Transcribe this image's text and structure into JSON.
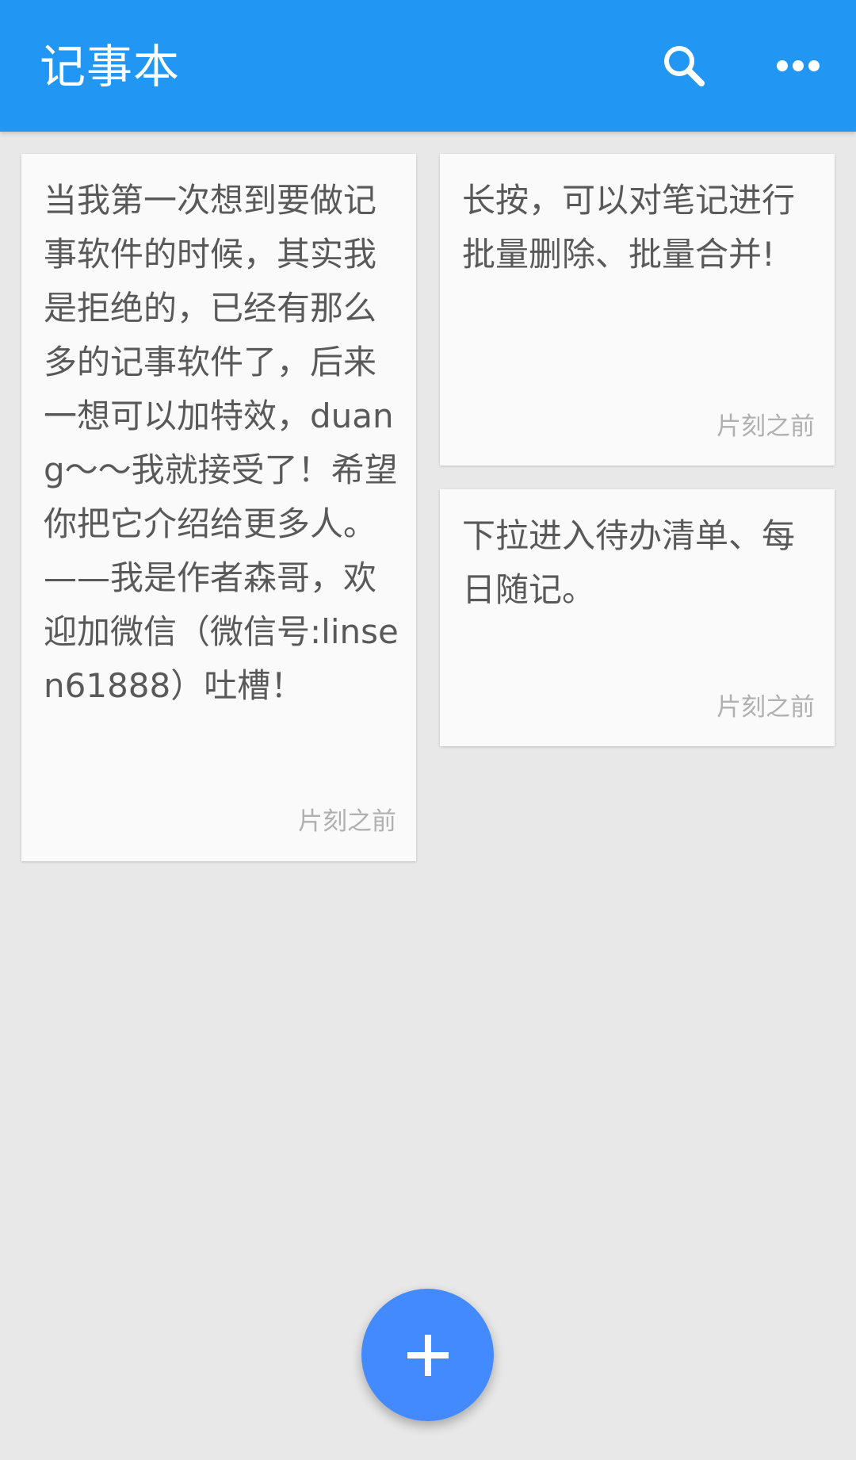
{
  "app_bar": {
    "title": "记事本",
    "background_color": "#2196f3",
    "actions": [
      {
        "icon": "search-icon"
      },
      {
        "icon": "more-horizontal-icon"
      }
    ]
  },
  "notes": [
    {
      "text": "当我第一次想到要做记事软件的时候，其实我是拒绝的，已经有那么多的记事软件了，后来一想可以加特效，duang～～我就接受了！希望你把它介绍给更多人。——我是作者森哥，欢迎加微信（微信号:linsen61888）吐槽！",
      "time": "片刻之前"
    },
    {
      "text": "长按，可以对笔记进行批量删除、批量合并!",
      "time": "片刻之前"
    },
    {
      "text": "下拉进入待办清单、每日随记。",
      "time": "片刻之前"
    }
  ],
  "fab": {
    "icon": "plus-icon",
    "color": "#448aff"
  }
}
